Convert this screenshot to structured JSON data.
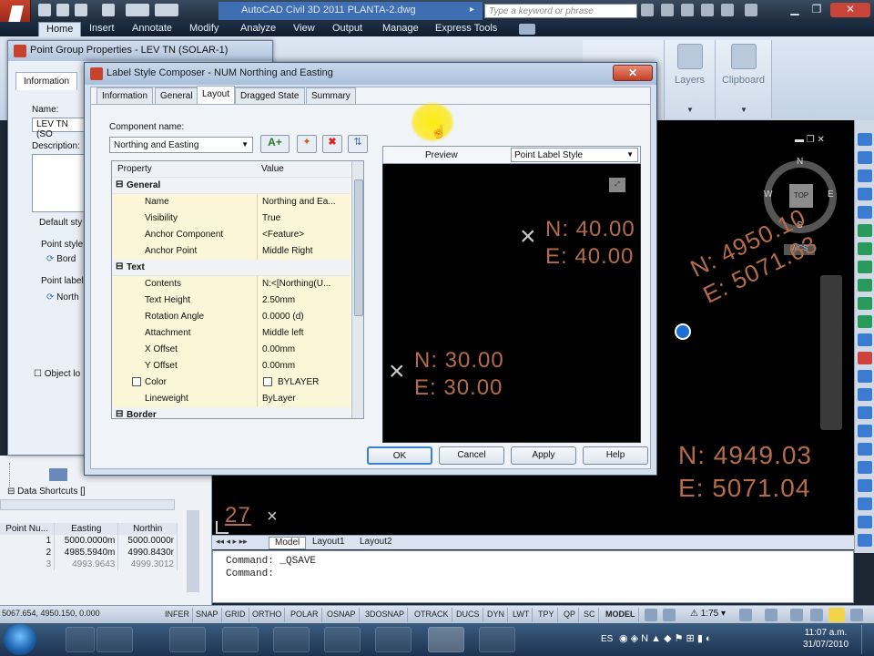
{
  "titlebar": {
    "title": "AutoCAD Civil 3D 2011   PLANTA-2.dwg",
    "search_placeholder": "Type a keyword or phrase"
  },
  "ribbon": {
    "tabs": [
      "Home",
      "Insert",
      "Annotate",
      "Modify",
      "Analyze",
      "View",
      "Output",
      "Manage",
      "Express Tools"
    ],
    "active_tab": "Home",
    "panels": [
      "Layers",
      "Clipboard"
    ]
  },
  "point_group_dialog": {
    "title": "Point Group Properties - LEV TN (SOLAR-1)",
    "tab": "Information",
    "name_label": "Name:",
    "name_value": "LEV TN (SO",
    "description_label": "Description:",
    "default_styles_label": "Default sty",
    "point_style_label": "Point style",
    "point_style_value": "Bord",
    "point_label_label": "Point label",
    "point_label_value": "North",
    "object_locked_label": "Object lo"
  },
  "label_style_composer": {
    "title": "Label Style Composer - NUM Northing and Easting",
    "tabs": [
      "Information",
      "General",
      "Layout",
      "Dragged State",
      "Summary"
    ],
    "active_tab": "Layout",
    "component_name_label": "Component name:",
    "component_name_value": "Northing and Easting",
    "grid_headers": {
      "property": "Property",
      "value": "Value"
    },
    "categories": [
      {
        "name": "General",
        "rows": [
          {
            "name": "Name",
            "value": "Northing and Ea..."
          },
          {
            "name": "Visibility",
            "value": "True"
          },
          {
            "name": "Anchor Component",
            "value": "<Feature>"
          },
          {
            "name": "Anchor Point",
            "value": "Middle Right"
          }
        ]
      },
      {
        "name": "Text",
        "rows": [
          {
            "name": "Contents",
            "value": "N:<[Northing(U..."
          },
          {
            "name": "Text Height",
            "value": "2.50mm"
          },
          {
            "name": "Rotation Angle",
            "value": "0.0000 (d)"
          },
          {
            "name": "Attachment",
            "value": "Middle left"
          },
          {
            "name": "X Offset",
            "value": "0.00mm"
          },
          {
            "name": "Y Offset",
            "value": "0.00mm"
          },
          {
            "name": "Color",
            "value": "BYLAYER"
          },
          {
            "name": "Lineweight",
            "value": "ByLayer"
          }
        ]
      },
      {
        "name": "Border",
        "rows": []
      }
    ],
    "preview_label": "Preview",
    "preview_select": "Point Label Style",
    "preview_points": [
      {
        "n": "N: 40.00",
        "e": "E: 40.00"
      },
      {
        "n": "N: 30.00",
        "e": "E: 30.00"
      }
    ],
    "buttons": {
      "ok": "OK",
      "cancel": "Cancel",
      "apply": "Apply",
      "help": "Help"
    }
  },
  "drawing": {
    "compass": {
      "n": "N",
      "s": "S",
      "e": "E",
      "w": "W",
      "center": "TOP",
      "wcs": "WCS"
    },
    "labels": [
      {
        "n": "N: 4950.10",
        "e": "E: 5071.63"
      },
      {
        "n": "N: 4949.03",
        "e": "E: 5071.04"
      }
    ],
    "point_number": "27"
  },
  "layout_tabs": [
    "Model",
    "Layout1",
    "Layout2"
  ],
  "command_lines": [
    "Command:  _QSAVE",
    "Command:"
  ],
  "prospector": {
    "data_shortcuts": "Data Shortcuts []",
    "columns": [
      "Point Nu...",
      "Easting",
      "Northin"
    ],
    "rows": [
      [
        "1",
        "5000.0000m",
        "5000.0000r"
      ],
      [
        "2",
        "4985.5940m",
        "4990.8430r"
      ],
      [
        "3",
        "4993.9643",
        "4999.3012"
      ]
    ]
  },
  "statusbar": {
    "coords": "5067.654, 4950.150, 0.000",
    "toggles": [
      "INFER",
      "SNAP",
      "GRID",
      "ORTHO",
      "POLAR",
      "OSNAP",
      "3DOSNAP",
      "OTRACK",
      "DUCS",
      "DYN",
      "LWT",
      "TPY",
      "QP",
      "SC"
    ],
    "model": "MODEL",
    "scale": "1:75"
  },
  "taskbar": {
    "language": "ES",
    "time": "11:07 a.m.",
    "date": "31/07/2010"
  }
}
